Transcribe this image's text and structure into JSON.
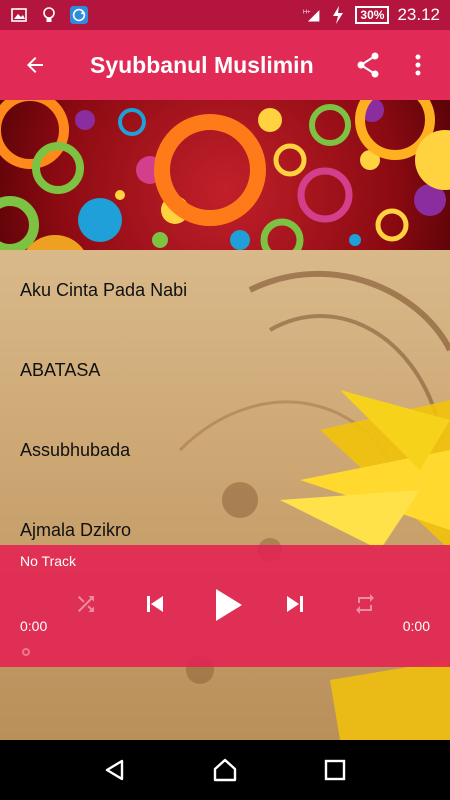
{
  "status_bar": {
    "battery": "30%",
    "time": "23.12",
    "network": "H+"
  },
  "app_bar": {
    "title": "Syubbanul Muslimin"
  },
  "tracks": [
    {
      "title": "Aku Cinta Pada Nabi"
    },
    {
      "title": "ABATASA"
    },
    {
      "title": "Assubhubada"
    },
    {
      "title": "Ajmala Dzikro"
    }
  ],
  "player": {
    "now_playing": "No Track",
    "elapsed": "0:00",
    "duration": "0:00",
    "progress": 0
  },
  "colors": {
    "status_bar": "#b3153f",
    "app_bar": "#e12a55",
    "player": "#e22452"
  }
}
